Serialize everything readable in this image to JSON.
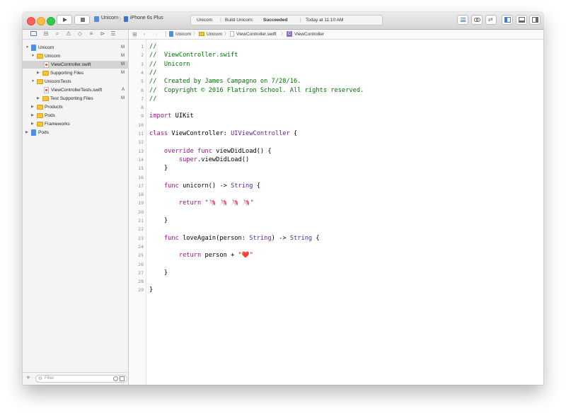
{
  "toolbar": {
    "scheme_target": "Unicorn",
    "scheme_device": "iPhone 6s Plus",
    "activity_project": "Unicorn",
    "activity_status_prefix": "Build Unicorn: ",
    "activity_status_result": "Succeeded",
    "activity_time": "Today at 11:10 AM"
  },
  "jumpbar": {
    "crumbs": [
      "Unicorn",
      "Unicorn",
      "ViewController.swift",
      "ViewController"
    ]
  },
  "navigator": {
    "rows": [
      {
        "label": "Unicorn",
        "badge": "M"
      },
      {
        "label": "Unicorn",
        "badge": "M"
      },
      {
        "label": "ViewController.swift",
        "badge": "M"
      },
      {
        "label": "Supporting Files",
        "badge": "M"
      },
      {
        "label": "UnicornTests",
        "badge": ""
      },
      {
        "label": "ViewControllerTests.swift",
        "badge": "A"
      },
      {
        "label": "Test Supporting Files",
        "badge": "M"
      },
      {
        "label": "Products",
        "badge": ""
      },
      {
        "label": "Pods",
        "badge": ""
      },
      {
        "label": "Frameworks",
        "badge": ""
      },
      {
        "label": "Pods",
        "badge": ""
      }
    ],
    "filter_placeholder": "Filter",
    "add_label": "+"
  },
  "editor": {
    "line_numbers": [
      "1",
      "2",
      "3",
      "4",
      "5",
      "6",
      "7",
      "8",
      "9",
      "10",
      "11",
      "12",
      "13",
      "14",
      "15",
      "16",
      "17",
      "18",
      "19",
      "20",
      "21",
      "22",
      "23",
      "24",
      "25",
      "26",
      "27",
      "28",
      "29"
    ],
    "lines": [
      [
        {
          "t": "cm",
          "v": "//"
        }
      ],
      [
        {
          "t": "cm",
          "v": "//  ViewController.swift"
        }
      ],
      [
        {
          "t": "cm",
          "v": "//  Unicorn"
        }
      ],
      [
        {
          "t": "cm",
          "v": "//"
        }
      ],
      [
        {
          "t": "cm",
          "v": "//  Created by James Campagno on 7/28/16."
        }
      ],
      [
        {
          "t": "cm",
          "v": "//  Copyright © 2016 Flatiron School. All rights reserved."
        }
      ],
      [
        {
          "t": "cm",
          "v": "//"
        }
      ],
      [],
      [
        {
          "t": "kw",
          "v": "import"
        },
        {
          "t": "pl",
          "v": " UIKit"
        }
      ],
      [],
      [
        {
          "t": "kw",
          "v": "class"
        },
        {
          "t": "pl",
          "v": " ViewController: "
        },
        {
          "t": "ty",
          "v": "UIViewController"
        },
        {
          "t": "pl",
          "v": " {"
        }
      ],
      [],
      [
        {
          "t": "pl",
          "v": "    "
        },
        {
          "t": "kw",
          "v": "override"
        },
        {
          "t": "pl",
          "v": " "
        },
        {
          "t": "kw",
          "v": "func"
        },
        {
          "t": "pl",
          "v": " viewDidLoad() {"
        }
      ],
      [
        {
          "t": "pl",
          "v": "        "
        },
        {
          "t": "kw",
          "v": "super"
        },
        {
          "t": "pl",
          "v": ".viewDidLoad()"
        }
      ],
      [
        {
          "t": "pl",
          "v": "    }"
        }
      ],
      [],
      [
        {
          "t": "pl",
          "v": "    "
        },
        {
          "t": "kw",
          "v": "func"
        },
        {
          "t": "pl",
          "v": " unicorn() -> "
        },
        {
          "t": "ty",
          "v": "String"
        },
        {
          "t": "pl",
          "v": " {"
        }
      ],
      [],
      [
        {
          "t": "pl",
          "v": "        "
        },
        {
          "t": "kw",
          "v": "return"
        },
        {
          "t": "pl",
          "v": " "
        },
        {
          "t": "st",
          "v": "\"🦄 🦄 🦄 🦄\""
        }
      ],
      [],
      [
        {
          "t": "pl",
          "v": "    }"
        }
      ],
      [],
      [
        {
          "t": "pl",
          "v": "    "
        },
        {
          "t": "kw",
          "v": "func"
        },
        {
          "t": "pl",
          "v": " loveAgain(person: "
        },
        {
          "t": "ty",
          "v": "String"
        },
        {
          "t": "pl",
          "v": ") -> "
        },
        {
          "t": "ty",
          "v": "String"
        },
        {
          "t": "pl",
          "v": " {"
        }
      ],
      [],
      [
        {
          "t": "pl",
          "v": "        "
        },
        {
          "t": "kw",
          "v": "return"
        },
        {
          "t": "pl",
          "v": " person + "
        },
        {
          "t": "st",
          "v": "\"❤️\""
        }
      ],
      [],
      [
        {
          "t": "pl",
          "v": "    }"
        }
      ],
      [],
      [
        {
          "t": "pl",
          "v": "}"
        }
      ]
    ]
  },
  "colors": {
    "keyword": "#aa0d91",
    "comment": "#007400",
    "type": "#5c2699",
    "string": "#c41a16",
    "selection": "#d4d4d4",
    "accent": "#3d7be0"
  }
}
